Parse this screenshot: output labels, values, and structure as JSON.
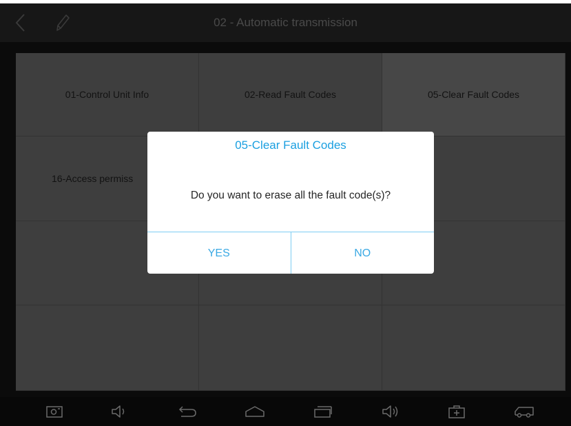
{
  "header": {
    "title": "02 - Automatic transmission",
    "back_icon": "chevron-left-icon",
    "edit_icon": "pencil-icon"
  },
  "menu": {
    "items": [
      {
        "label": "01-Control Unit Info"
      },
      {
        "label": "02-Read Fault Codes"
      },
      {
        "label": "05-Clear Fault Codes"
      },
      {
        "label": "16-Access permiss"
      },
      {
        "label": ""
      },
      {
        "label": ""
      },
      {
        "label": ""
      },
      {
        "label": ""
      },
      {
        "label": ""
      },
      {
        "label": ""
      },
      {
        "label": ""
      },
      {
        "label": ""
      }
    ]
  },
  "dialog": {
    "title": "05-Clear Fault Codes",
    "message": "Do you want to erase all the fault code(s)?",
    "yes_label": "YES",
    "no_label": "NO"
  },
  "nav_bar": {
    "icons": [
      "screenshot-icon",
      "volume-down-icon",
      "back-icon",
      "home-icon",
      "recent-apps-icon",
      "volume-up-icon",
      "toolbox-icon",
      "vehicle-icon"
    ]
  },
  "colors": {
    "accent": "#1a9fe0",
    "divider": "#7dcdf3",
    "header_text": "#4a4a4a",
    "tile": "#3e3e3e"
  }
}
